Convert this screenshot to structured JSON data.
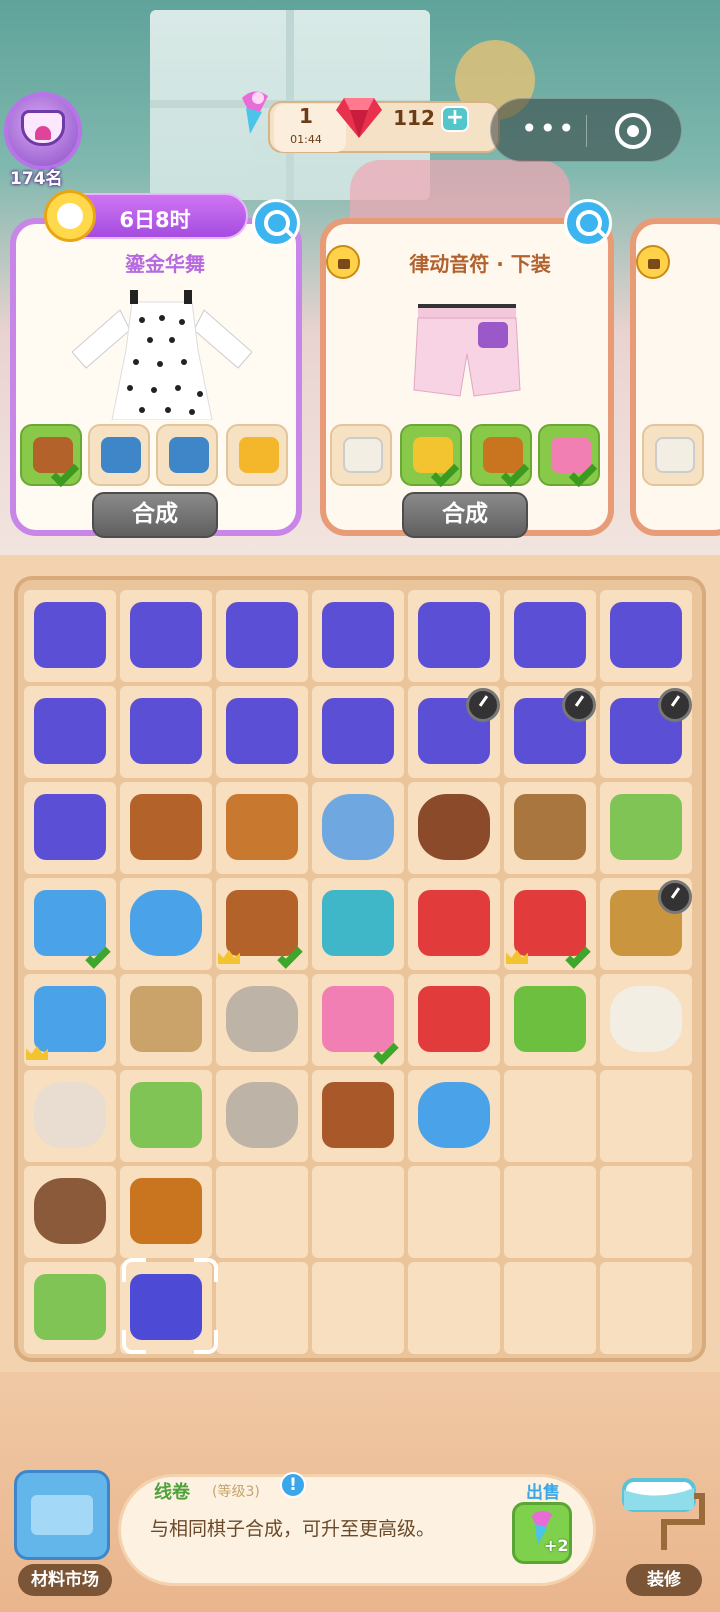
{
  "player": {
    "rank": "174名"
  },
  "resources": {
    "energy": "1",
    "energy_timer": "01:44",
    "gems": "112"
  },
  "orders": [
    {
      "timer": "6日8时",
      "title": "鎏金华舞",
      "craft_label": "合成",
      "locked": false
    },
    {
      "title": "律动音符 · 下装",
      "craft_label": "合成",
      "locked": true
    },
    {
      "locked": true
    }
  ],
  "board": {
    "rows": 8,
    "cols": 7,
    "cells": [
      "sewing-box",
      "sewing-box",
      "sewing-box",
      "sewing-box",
      "sewing-box",
      "sewing-box",
      "sewing-box",
      "sewing-box",
      "sewing-box",
      "sewing-box",
      "sewing-box",
      "sewing-box-cooldown",
      "sewing-box-cooldown",
      "sewing-box-cooldown",
      "sewing-box",
      "leather-scraps",
      "leather-piece",
      "stone-cart",
      "cotton-crate",
      "cloth-roll-basket",
      "sheep-on-grass",
      "gold-bar-box",
      "stone-bucket",
      "leather-bag",
      "fabric-folds",
      "wood-log-box",
      "wood-log-box",
      "sack-cooldown",
      "crafting-kit",
      "sprout-box",
      "stone",
      "mixer",
      "wood-log-box",
      "leather-bowl",
      "cotton-ball",
      "cloth-cotton",
      "flower-pot",
      "stones",
      "leather-sheet",
      "stone-shovel",
      "",
      "",
      "cotton-basket",
      "wood-logs",
      "",
      "",
      "",
      "",
      "",
      "silkworm-leaf",
      "thread-spool",
      "",
      "",
      "",
      "",
      ""
    ],
    "checked": [
      "3-0",
      "3-2",
      "3-5",
      "4-3"
    ],
    "crowned": [
      "3-2",
      "3-5",
      "4-0"
    ],
    "selected": "7-1"
  },
  "info": {
    "item_name": "线卷",
    "level": "(等级3)",
    "description": "与相同棋子合成，可升至更高级。",
    "sell_label": "出售",
    "sell_value": "+2"
  },
  "bottom": {
    "market_label": "材料市场",
    "decorate_label": "装修"
  },
  "colors": {
    "accent_purple": "#c886e8",
    "accent_orange": "#e89b77",
    "board": "#eac59c",
    "check_green": "#3ea62a"
  }
}
